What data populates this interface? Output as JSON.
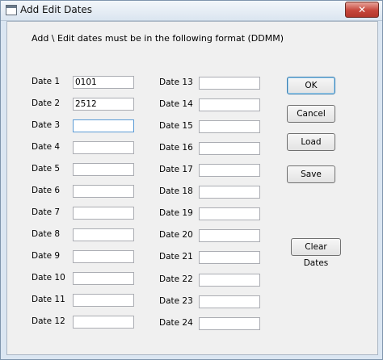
{
  "window": {
    "title": "Add Edit Dates",
    "close_glyph": "✕"
  },
  "instruction": "Add \\  Edit dates must be in the following format (DDMM)",
  "left_column": [
    {
      "label": "Date 1",
      "value": "0101"
    },
    {
      "label": "Date 2",
      "value": "2512"
    },
    {
      "label": "Date 3",
      "value": ""
    },
    {
      "label": "Date 4",
      "value": ""
    },
    {
      "label": "Date 5",
      "value": ""
    },
    {
      "label": "Date 6",
      "value": ""
    },
    {
      "label": "Date 7",
      "value": ""
    },
    {
      "label": "Date 8",
      "value": ""
    },
    {
      "label": "Date 9",
      "value": ""
    },
    {
      "label": "Date 10",
      "value": ""
    },
    {
      "label": "Date 11",
      "value": ""
    },
    {
      "label": "Date 12",
      "value": ""
    }
  ],
  "right_column": [
    {
      "label": "Date 13",
      "value": ""
    },
    {
      "label": "Date 14",
      "value": ""
    },
    {
      "label": "Date 15",
      "value": ""
    },
    {
      "label": "Date 16",
      "value": ""
    },
    {
      "label": "Date 17",
      "value": ""
    },
    {
      "label": "Date 18",
      "value": ""
    },
    {
      "label": "Date 19",
      "value": ""
    },
    {
      "label": "Date 20",
      "value": ""
    },
    {
      "label": "Date 21",
      "value": ""
    },
    {
      "label": "Date 22",
      "value": ""
    },
    {
      "label": "Date 23",
      "value": ""
    },
    {
      "label": "Date 24",
      "value": ""
    }
  ],
  "buttons": {
    "ok": "OK",
    "cancel": "Cancel",
    "load": "Load",
    "save": "Save",
    "clear": "Clear Dates"
  }
}
